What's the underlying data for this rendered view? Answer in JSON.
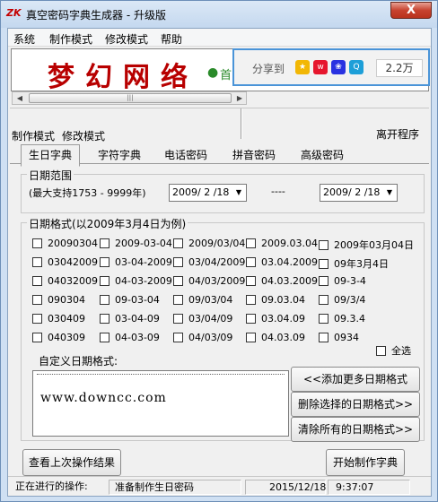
{
  "window": {
    "title": "真空密码字典生成器 - 升级版",
    "app_icon_text": "ZK",
    "close_glyph": "X"
  },
  "menu": [
    "系统",
    "制作模式",
    "修改模式",
    "帮助"
  ],
  "banner": {
    "logo": "梦幻网络",
    "home_text": "首",
    "share_label": "分享到",
    "share_count": "2.2万",
    "share_icons": [
      {
        "icon": "qzone-icon",
        "color": "#f2b705"
      },
      {
        "icon": "weibo-icon",
        "color": "#e6162d"
      },
      {
        "icon": "baidu-icon",
        "color": "#2932e1"
      },
      {
        "icon": "qq-weibo-icon",
        "color": "#1d9fd8"
      }
    ]
  },
  "modes": {
    "make": "制作模式",
    "modify": "修改模式",
    "quit": "离开程序"
  },
  "tabs": [
    "生日字典",
    "字符字典",
    "电话密码",
    "拼音密码",
    "高级密码"
  ],
  "date_range": {
    "title": "日期范围",
    "hint": "(最大支持1753 - 9999年)",
    "from": "2009/ 2 /18",
    "separator": "----",
    "to": "2009/ 2 /18"
  },
  "date_format": {
    "title": "日期格式(以2009年3月4日为例)",
    "rows": [
      [
        "20090304",
        "2009-03-04",
        "2009/03/04",
        "2009.03.04",
        "2009年03月04日"
      ],
      [
        "03042009",
        "03-04-2009",
        "03/04/2009",
        "03.04.2009",
        "09年3月4日"
      ],
      [
        "04032009",
        "04-03-2009",
        "04/03/2009",
        "04.03.2009",
        "09-3-4"
      ],
      [
        "090304",
        "09-03-04",
        "09/03/04",
        "09.03.04",
        "09/3/4"
      ],
      [
        "030409",
        "03-04-09",
        "03/04/09",
        "03.04.09",
        "09.3.4"
      ],
      [
        "040309",
        "04-03-09",
        "04/03/09",
        "04.03.09",
        "0934"
      ]
    ],
    "select_all": "全选",
    "custom_label": "自定义日期格式:",
    "custom_text": "www.downcc.com",
    "add_more": "<<添加更多日期格式",
    "delete_selected": "删除选择的日期格式>>",
    "clear_all": "清除所有的日期格式>>"
  },
  "actions": {
    "view_last": "查看上次操作结果",
    "start": "开始制作字典"
  },
  "status": {
    "label": "正在进行的操作:",
    "message": "准备制作生日密码",
    "date": "2015/12/18",
    "time": "9:37:07"
  }
}
